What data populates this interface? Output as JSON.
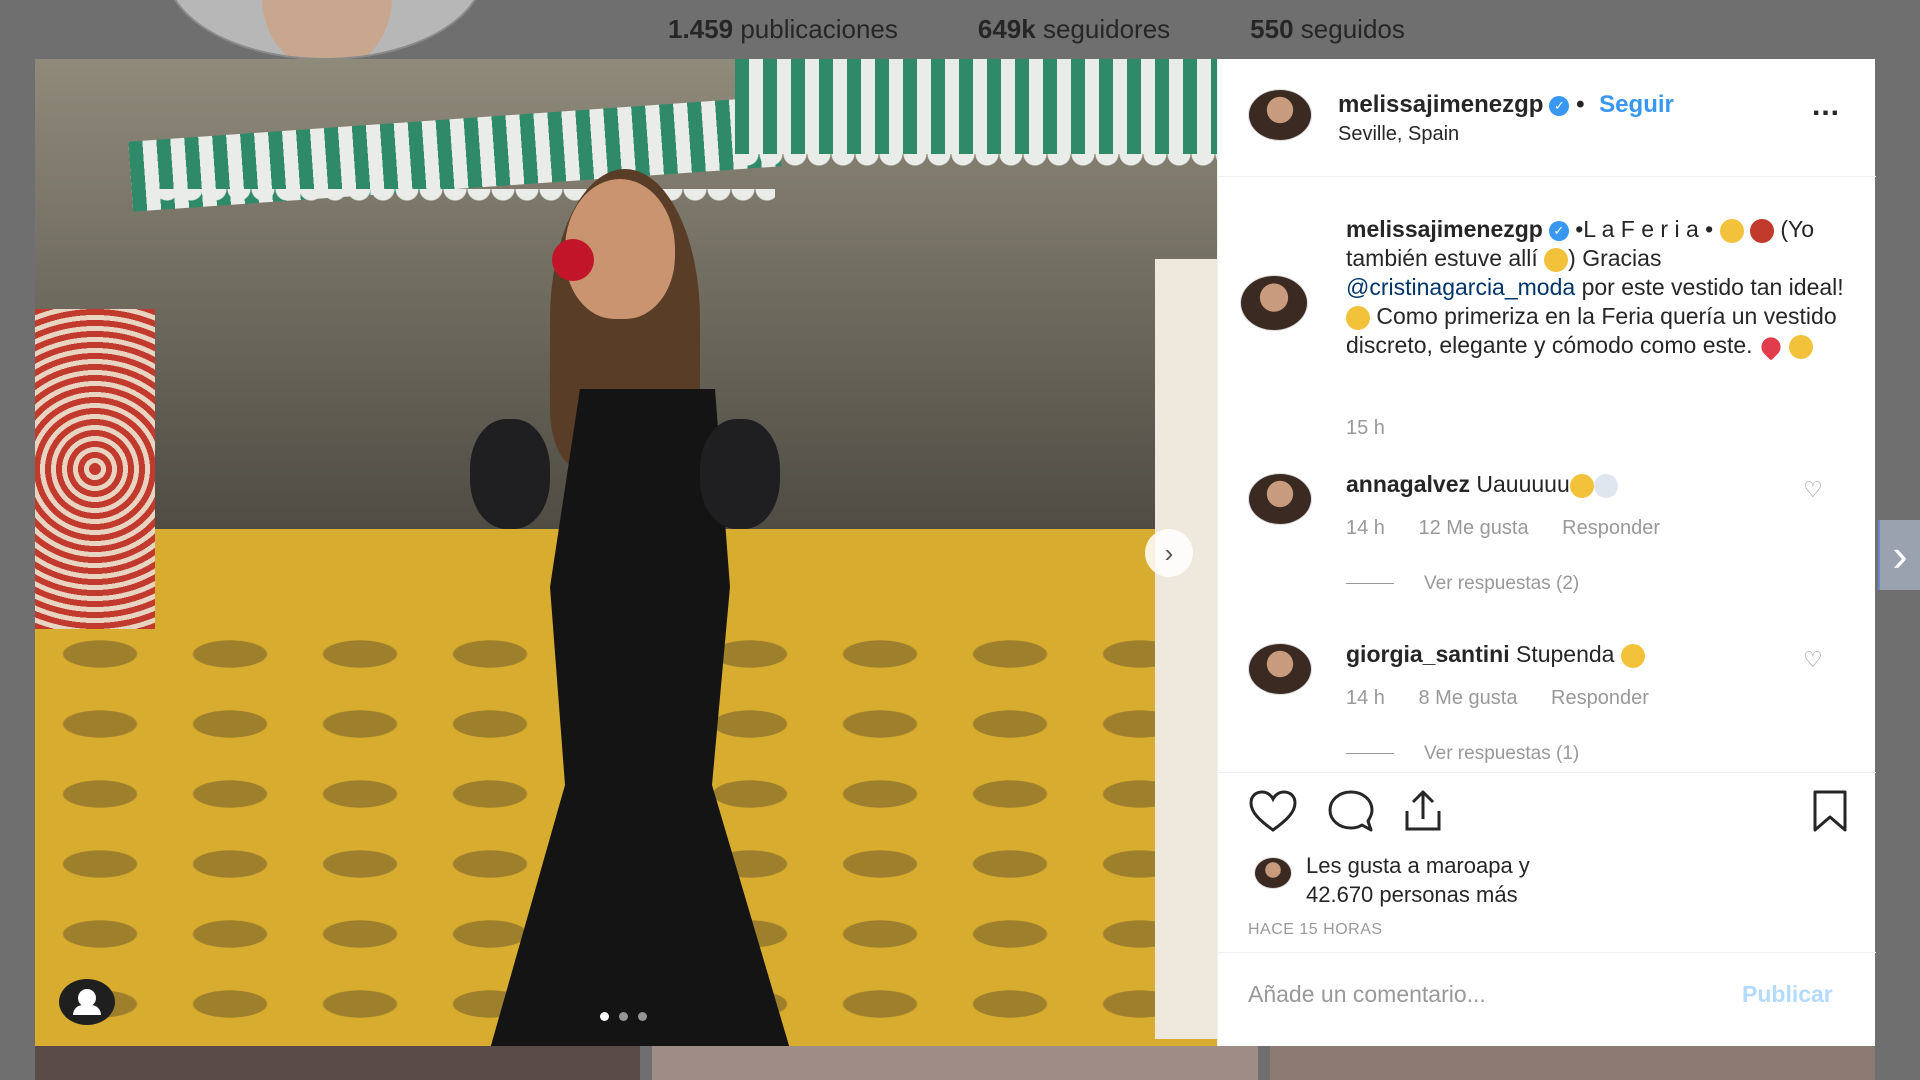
{
  "profile": {
    "stats": {
      "posts": "1.459",
      "posts_label": "publicaciones",
      "followers": "649k",
      "followers_label": "seguidores",
      "following": "550",
      "following_label": "seguidos"
    }
  },
  "post": {
    "username": "melissajimenezgp",
    "separator": "•",
    "follow_label": "Seguir",
    "location": "Seville, Spain",
    "more_label": "...",
    "caption_parts": {
      "title": "•L a F e r i a •",
      "text1": "(Yo también estuve allí",
      "text2": ") Gracias",
      "mention": "@cristinagarcia_moda",
      "text3": "por este vestido tan ideal!",
      "text4": "Como primeriza en la Feria quería un vestido discreto, elegante y cómodo como este."
    },
    "caption_time": "15 h",
    "comments": [
      {
        "username": "annagalvez",
        "text": "Uauuuuu",
        "time": "14 h",
        "likes": "12 Me gusta",
        "reply_label": "Responder",
        "view_replies": "Ver respuestas (2)"
      },
      {
        "username": "giorgia_santini",
        "text": "Stupenda",
        "time": "14 h",
        "likes": "8 Me gusta",
        "reply_label": "Responder",
        "view_replies": "Ver respuestas (1)"
      }
    ],
    "likes_line1": "Les gusta a maroapa y",
    "likes_line2": "42.670 personas más",
    "posted_ago": "HACE 15 HORAS",
    "comment_placeholder": "Añade un comentario...",
    "publish_label": "Publicar",
    "carousel": {
      "total": 3,
      "current": 1
    }
  },
  "colors": {
    "accent": "#3897f0",
    "muted": "#999999",
    "publish_disabled": "#b3dbff",
    "mention": "#003569"
  },
  "icons": [
    "verified-badge-icon",
    "more-options-icon",
    "heart-icon",
    "comment-icon",
    "share-icon",
    "bookmark-icon",
    "chevron-right-icon",
    "user-tag-icon"
  ]
}
